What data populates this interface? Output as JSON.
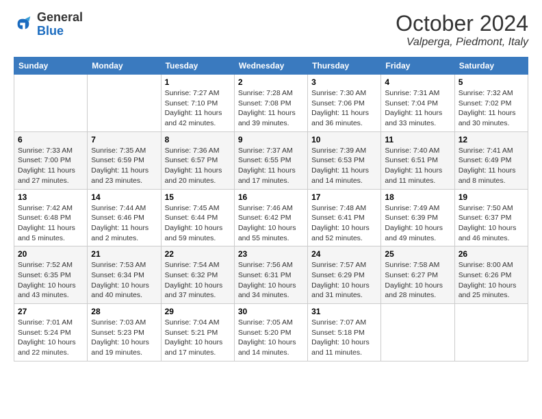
{
  "header": {
    "logo_general": "General",
    "logo_blue": "Blue",
    "title": "October 2024",
    "location": "Valperga, Piedmont, Italy"
  },
  "days_of_week": [
    "Sunday",
    "Monday",
    "Tuesday",
    "Wednesday",
    "Thursday",
    "Friday",
    "Saturday"
  ],
  "weeks": [
    [
      {
        "day": "",
        "info": ""
      },
      {
        "day": "",
        "info": ""
      },
      {
        "day": "1",
        "info": "Sunrise: 7:27 AM\nSunset: 7:10 PM\nDaylight: 11 hours and 42 minutes."
      },
      {
        "day": "2",
        "info": "Sunrise: 7:28 AM\nSunset: 7:08 PM\nDaylight: 11 hours and 39 minutes."
      },
      {
        "day": "3",
        "info": "Sunrise: 7:30 AM\nSunset: 7:06 PM\nDaylight: 11 hours and 36 minutes."
      },
      {
        "day": "4",
        "info": "Sunrise: 7:31 AM\nSunset: 7:04 PM\nDaylight: 11 hours and 33 minutes."
      },
      {
        "day": "5",
        "info": "Sunrise: 7:32 AM\nSunset: 7:02 PM\nDaylight: 11 hours and 30 minutes."
      }
    ],
    [
      {
        "day": "6",
        "info": "Sunrise: 7:33 AM\nSunset: 7:00 PM\nDaylight: 11 hours and 27 minutes."
      },
      {
        "day": "7",
        "info": "Sunrise: 7:35 AM\nSunset: 6:59 PM\nDaylight: 11 hours and 23 minutes."
      },
      {
        "day": "8",
        "info": "Sunrise: 7:36 AM\nSunset: 6:57 PM\nDaylight: 11 hours and 20 minutes."
      },
      {
        "day": "9",
        "info": "Sunrise: 7:37 AM\nSunset: 6:55 PM\nDaylight: 11 hours and 17 minutes."
      },
      {
        "day": "10",
        "info": "Sunrise: 7:39 AM\nSunset: 6:53 PM\nDaylight: 11 hours and 14 minutes."
      },
      {
        "day": "11",
        "info": "Sunrise: 7:40 AM\nSunset: 6:51 PM\nDaylight: 11 hours and 11 minutes."
      },
      {
        "day": "12",
        "info": "Sunrise: 7:41 AM\nSunset: 6:49 PM\nDaylight: 11 hours and 8 minutes."
      }
    ],
    [
      {
        "day": "13",
        "info": "Sunrise: 7:42 AM\nSunset: 6:48 PM\nDaylight: 11 hours and 5 minutes."
      },
      {
        "day": "14",
        "info": "Sunrise: 7:44 AM\nSunset: 6:46 PM\nDaylight: 11 hours and 2 minutes."
      },
      {
        "day": "15",
        "info": "Sunrise: 7:45 AM\nSunset: 6:44 PM\nDaylight: 10 hours and 59 minutes."
      },
      {
        "day": "16",
        "info": "Sunrise: 7:46 AM\nSunset: 6:42 PM\nDaylight: 10 hours and 55 minutes."
      },
      {
        "day": "17",
        "info": "Sunrise: 7:48 AM\nSunset: 6:41 PM\nDaylight: 10 hours and 52 minutes."
      },
      {
        "day": "18",
        "info": "Sunrise: 7:49 AM\nSunset: 6:39 PM\nDaylight: 10 hours and 49 minutes."
      },
      {
        "day": "19",
        "info": "Sunrise: 7:50 AM\nSunset: 6:37 PM\nDaylight: 10 hours and 46 minutes."
      }
    ],
    [
      {
        "day": "20",
        "info": "Sunrise: 7:52 AM\nSunset: 6:35 PM\nDaylight: 10 hours and 43 minutes."
      },
      {
        "day": "21",
        "info": "Sunrise: 7:53 AM\nSunset: 6:34 PM\nDaylight: 10 hours and 40 minutes."
      },
      {
        "day": "22",
        "info": "Sunrise: 7:54 AM\nSunset: 6:32 PM\nDaylight: 10 hours and 37 minutes."
      },
      {
        "day": "23",
        "info": "Sunrise: 7:56 AM\nSunset: 6:31 PM\nDaylight: 10 hours and 34 minutes."
      },
      {
        "day": "24",
        "info": "Sunrise: 7:57 AM\nSunset: 6:29 PM\nDaylight: 10 hours and 31 minutes."
      },
      {
        "day": "25",
        "info": "Sunrise: 7:58 AM\nSunset: 6:27 PM\nDaylight: 10 hours and 28 minutes."
      },
      {
        "day": "26",
        "info": "Sunrise: 8:00 AM\nSunset: 6:26 PM\nDaylight: 10 hours and 25 minutes."
      }
    ],
    [
      {
        "day": "27",
        "info": "Sunrise: 7:01 AM\nSunset: 5:24 PM\nDaylight: 10 hours and 22 minutes."
      },
      {
        "day": "28",
        "info": "Sunrise: 7:03 AM\nSunset: 5:23 PM\nDaylight: 10 hours and 19 minutes."
      },
      {
        "day": "29",
        "info": "Sunrise: 7:04 AM\nSunset: 5:21 PM\nDaylight: 10 hours and 17 minutes."
      },
      {
        "day": "30",
        "info": "Sunrise: 7:05 AM\nSunset: 5:20 PM\nDaylight: 10 hours and 14 minutes."
      },
      {
        "day": "31",
        "info": "Sunrise: 7:07 AM\nSunset: 5:18 PM\nDaylight: 10 hours and 11 minutes."
      },
      {
        "day": "",
        "info": ""
      },
      {
        "day": "",
        "info": ""
      }
    ]
  ]
}
